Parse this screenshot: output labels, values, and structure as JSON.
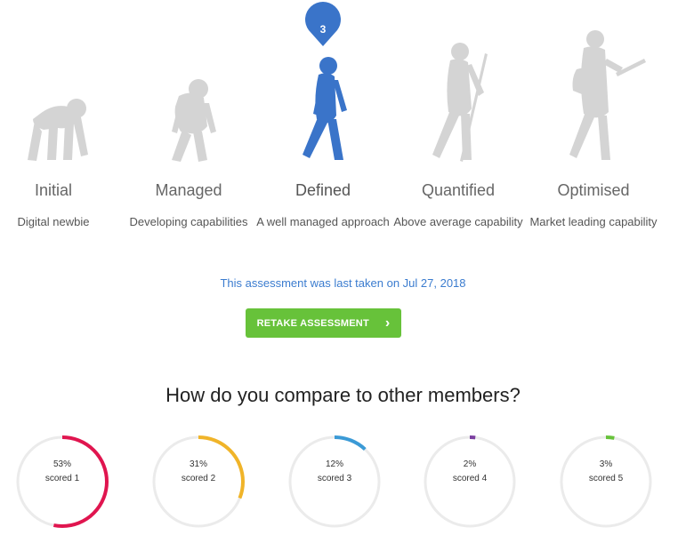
{
  "levels": [
    {
      "name": "Initial",
      "description": "Digital newbie",
      "icon": "crouching-ape-icon"
    },
    {
      "name": "Managed",
      "description": "Developing capabilities",
      "icon": "hunched-hominid-icon"
    },
    {
      "name": "Defined",
      "description": "A well managed approach",
      "icon": "walking-human-icon"
    },
    {
      "name": "Quantified",
      "description": "Above average capability",
      "icon": "human-with-staff-icon"
    },
    {
      "name": "Optimised",
      "description": "Market leading capability",
      "icon": "human-with-tablet-icon"
    }
  ],
  "current_level": {
    "marker": "3",
    "color": "#3a74c9"
  },
  "inactive_color": "#d4d4d4",
  "last_taken_text": "This assessment was last taken on Jul 27, 2018",
  "retake_button": {
    "label": "RETAKE ASSESSMENT",
    "chevron": "›",
    "color": "#67c23a"
  },
  "compare_title": "How do you compare to other members?",
  "distribution": [
    {
      "percent": "53%",
      "label": "scored 1",
      "fraction": 0.53,
      "color": "#e0154f"
    },
    {
      "percent": "31%",
      "label": "scored 2",
      "fraction": 0.31,
      "color": "#f0b429"
    },
    {
      "percent": "12%",
      "label": "scored 3",
      "fraction": 0.12,
      "color": "#3b9ad6"
    },
    {
      "percent": "2%",
      "label": "scored 4",
      "fraction": 0.02,
      "color": "#7b3fa0"
    },
    {
      "percent": "3%",
      "label": "scored 5",
      "fraction": 0.03,
      "color": "#67c23a"
    }
  ],
  "ring_track_color": "#ebebeb"
}
